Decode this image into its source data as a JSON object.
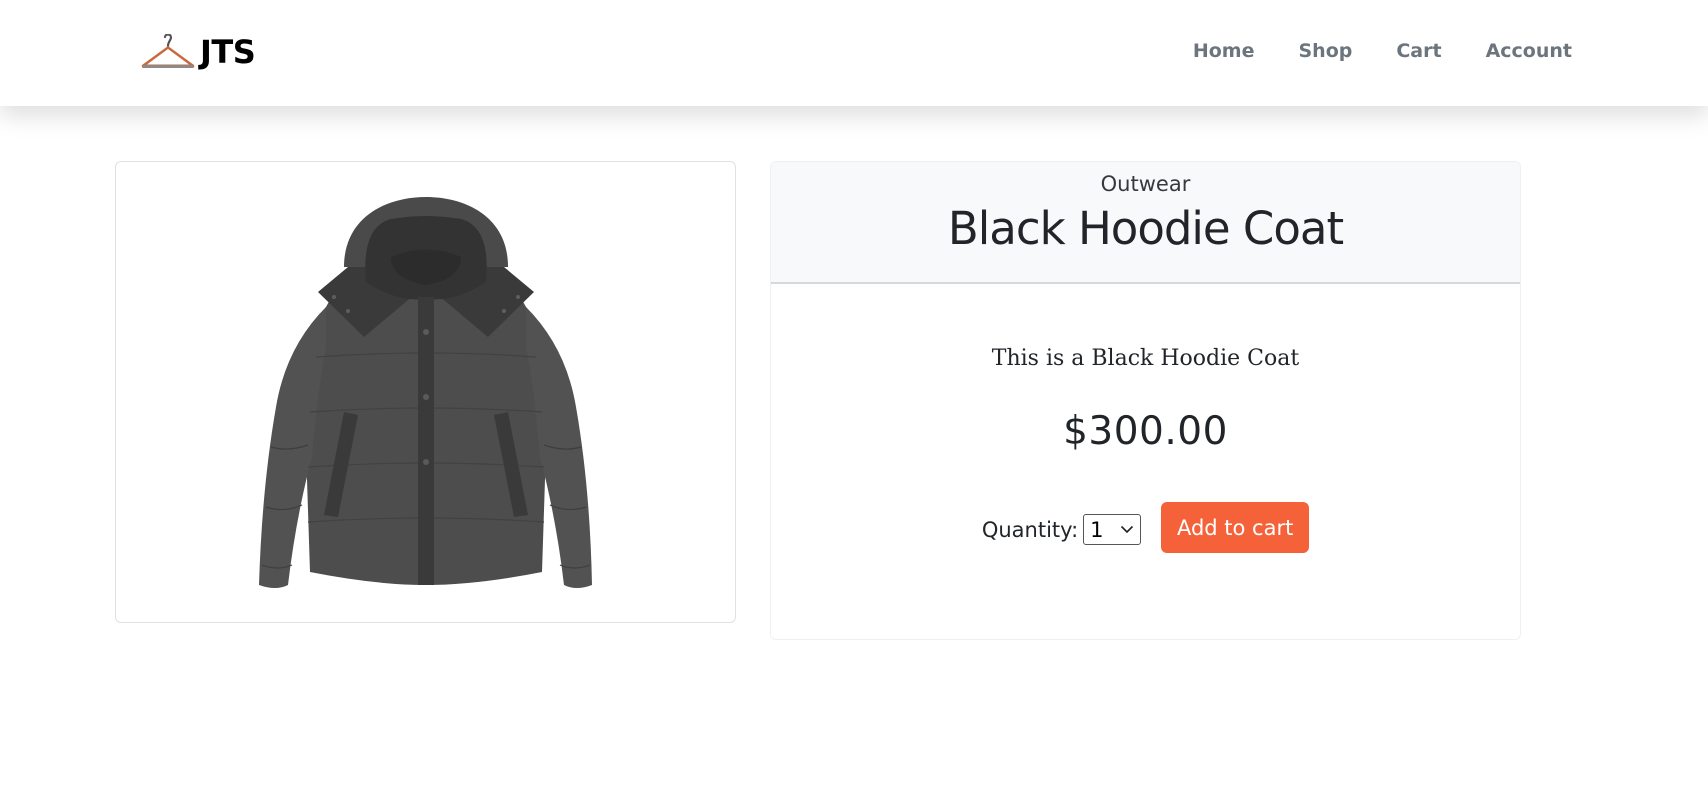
{
  "brand": {
    "name": "JTS",
    "logo_icon": "hanger-icon"
  },
  "nav": {
    "items": [
      {
        "label": "Home"
      },
      {
        "label": "Shop"
      },
      {
        "label": "Cart"
      },
      {
        "label": "Account"
      }
    ]
  },
  "product": {
    "category": "Outwear",
    "title": "Black Hoodie Coat",
    "description": "This is a Black Hoodie Coat",
    "price": "$300.00",
    "image_icon": "hoodie-coat-image"
  },
  "purchase": {
    "quantity_label": "Quantity:",
    "quantity_value": "1",
    "add_to_cart_label": "Add to cart"
  },
  "colors": {
    "accent": "#f5623a",
    "nav_text": "#6c757d",
    "header_bg": "#f8f9fa"
  }
}
